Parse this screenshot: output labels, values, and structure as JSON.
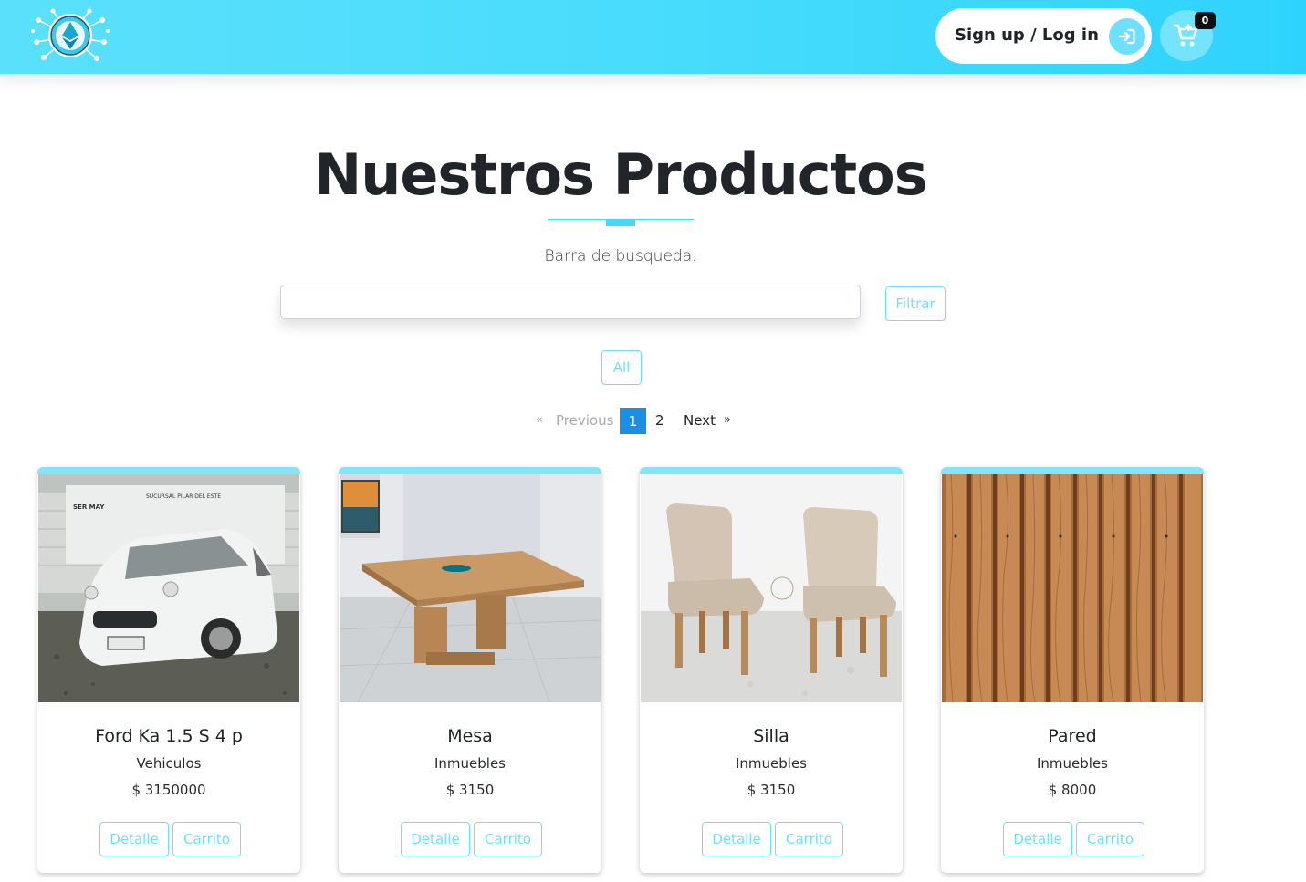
{
  "header": {
    "auth_label": "Sign up / Log in",
    "cart_count": "0",
    "logo_icon": "ethereum-diamond-icon",
    "auth_icon": "sign-in-icon",
    "cart_icon": "cart-plus-icon"
  },
  "main": {
    "title": "Nuestros Productos",
    "search_label": "Barra de busqueda.",
    "search_value": "",
    "filter_label": "Filtrar",
    "all_label": "All"
  },
  "pagination": {
    "prev_arrow": "«",
    "prev_label": "Previous",
    "pages": [
      "1",
      "2"
    ],
    "active_page": "1",
    "next_label": "Next",
    "next_arrow": "»"
  },
  "products": [
    {
      "name": "Ford Ka 1.5 S 4 p",
      "category": "Vehiculos",
      "price": "$ 3150000",
      "detail_label": "Detalle",
      "cart_label": "Carrito",
      "image_icon": "car-photo"
    },
    {
      "name": "Mesa",
      "category": "Inmuebles",
      "price": "$ 3150",
      "detail_label": "Detalle",
      "cart_label": "Carrito",
      "image_icon": "table-photo"
    },
    {
      "name": "Silla",
      "category": "Inmuebles",
      "price": "$ 3150",
      "detail_label": "Detalle",
      "cart_label": "Carrito",
      "image_icon": "chairs-photo"
    },
    {
      "name": "Pared",
      "category": "Inmuebles",
      "price": "$ 8000",
      "detail_label": "Detalle",
      "cart_label": "Carrito",
      "image_icon": "wood-wall-photo"
    }
  ],
  "colors": {
    "header_start": "#5be0fb",
    "header_end": "#2ed3fd",
    "accent": "#44d9f8",
    "active_page": "#1b8fe4",
    "outline_button": "#6fe0fb"
  }
}
